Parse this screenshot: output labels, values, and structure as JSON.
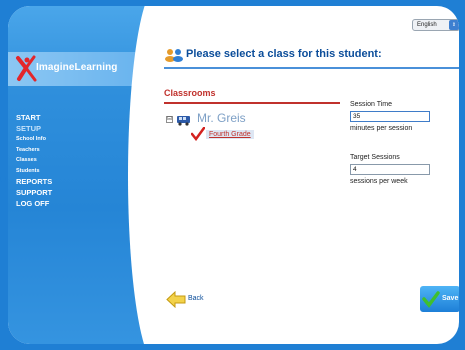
{
  "app": {
    "logo_text": "ImagineLearning"
  },
  "language": {
    "selected": "English"
  },
  "sidebar": {
    "items": [
      {
        "label": "START",
        "sub": false,
        "dim": false
      },
      {
        "label": "SETUP",
        "sub": false,
        "dim": true
      },
      {
        "label": "School Info",
        "sub": true,
        "dim": false
      },
      {
        "label": "Teachers",
        "sub": true,
        "dim": false
      },
      {
        "label": "Classes",
        "sub": true,
        "dim": false
      },
      {
        "label": "Students",
        "sub": true,
        "dim": false
      },
      {
        "label": "REPORTS",
        "sub": false,
        "dim": false
      },
      {
        "label": "SUPPORT",
        "sub": false,
        "dim": false
      },
      {
        "label": "LOG OFF",
        "sub": false,
        "dim": false
      }
    ]
  },
  "header": {
    "title": "Please select a class for this student:"
  },
  "classrooms": {
    "title": "Classrooms",
    "tree_toggle": "⊟",
    "teacher": "Mr. Greis",
    "class_name": "Fourth Grade"
  },
  "session_time": {
    "label": "Session Time",
    "value": "35",
    "unit": "minutes per session"
  },
  "target_sessions": {
    "label": "Target Sessions",
    "value": "4",
    "unit": "sessions per week"
  },
  "actions": {
    "back_label": "Back",
    "save_label": "Save"
  },
  "colors": {
    "frame": "#1f7fd4",
    "accent_red": "#c0312c",
    "title_blue": "#0b4d9a"
  }
}
